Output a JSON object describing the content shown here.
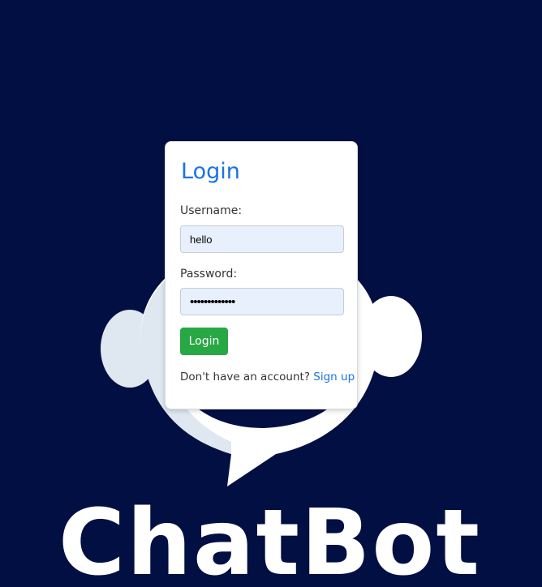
{
  "colors": {
    "background": "#020f42",
    "accent": "#1a73e8",
    "button": "#28a745",
    "input_fill": "#e8f0fe"
  },
  "logo": {
    "text": "ChatBot",
    "icon": "headset-chat-bubble-icon"
  },
  "login_form": {
    "title": "Login",
    "username_label": "Username:",
    "username_value": "hello",
    "password_label": "Password:",
    "password_value": "•••••••••••••",
    "submit_label": "Login",
    "signup_prompt": "Don't have an account?",
    "signup_link": "Sign up"
  }
}
